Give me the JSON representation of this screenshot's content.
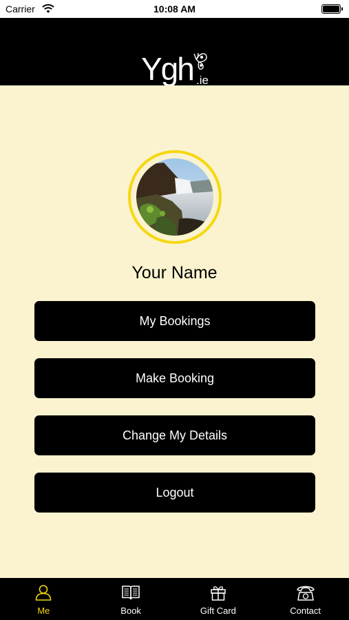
{
  "status_bar": {
    "carrier": "Carrier",
    "time": "10:08 AM"
  },
  "header": {
    "logo_text": "Ygh",
    "logo_suffix": ".ie"
  },
  "profile": {
    "name": "Your Name"
  },
  "menu": {
    "my_bookings": "My Bookings",
    "make_booking": "Make Booking",
    "change_details": "Change My Details",
    "logout": "Logout"
  },
  "tabs": [
    {
      "label": "Me",
      "icon": "person-icon",
      "active": true
    },
    {
      "label": "Book",
      "icon": "book-icon",
      "active": false
    },
    {
      "label": "Gift Card",
      "icon": "gift-icon",
      "active": false
    },
    {
      "label": "Contact",
      "icon": "phone-icon",
      "active": false
    }
  ],
  "colors": {
    "accent": "#f5d80f",
    "background": "#fbf3cf",
    "bar": "#000000"
  }
}
